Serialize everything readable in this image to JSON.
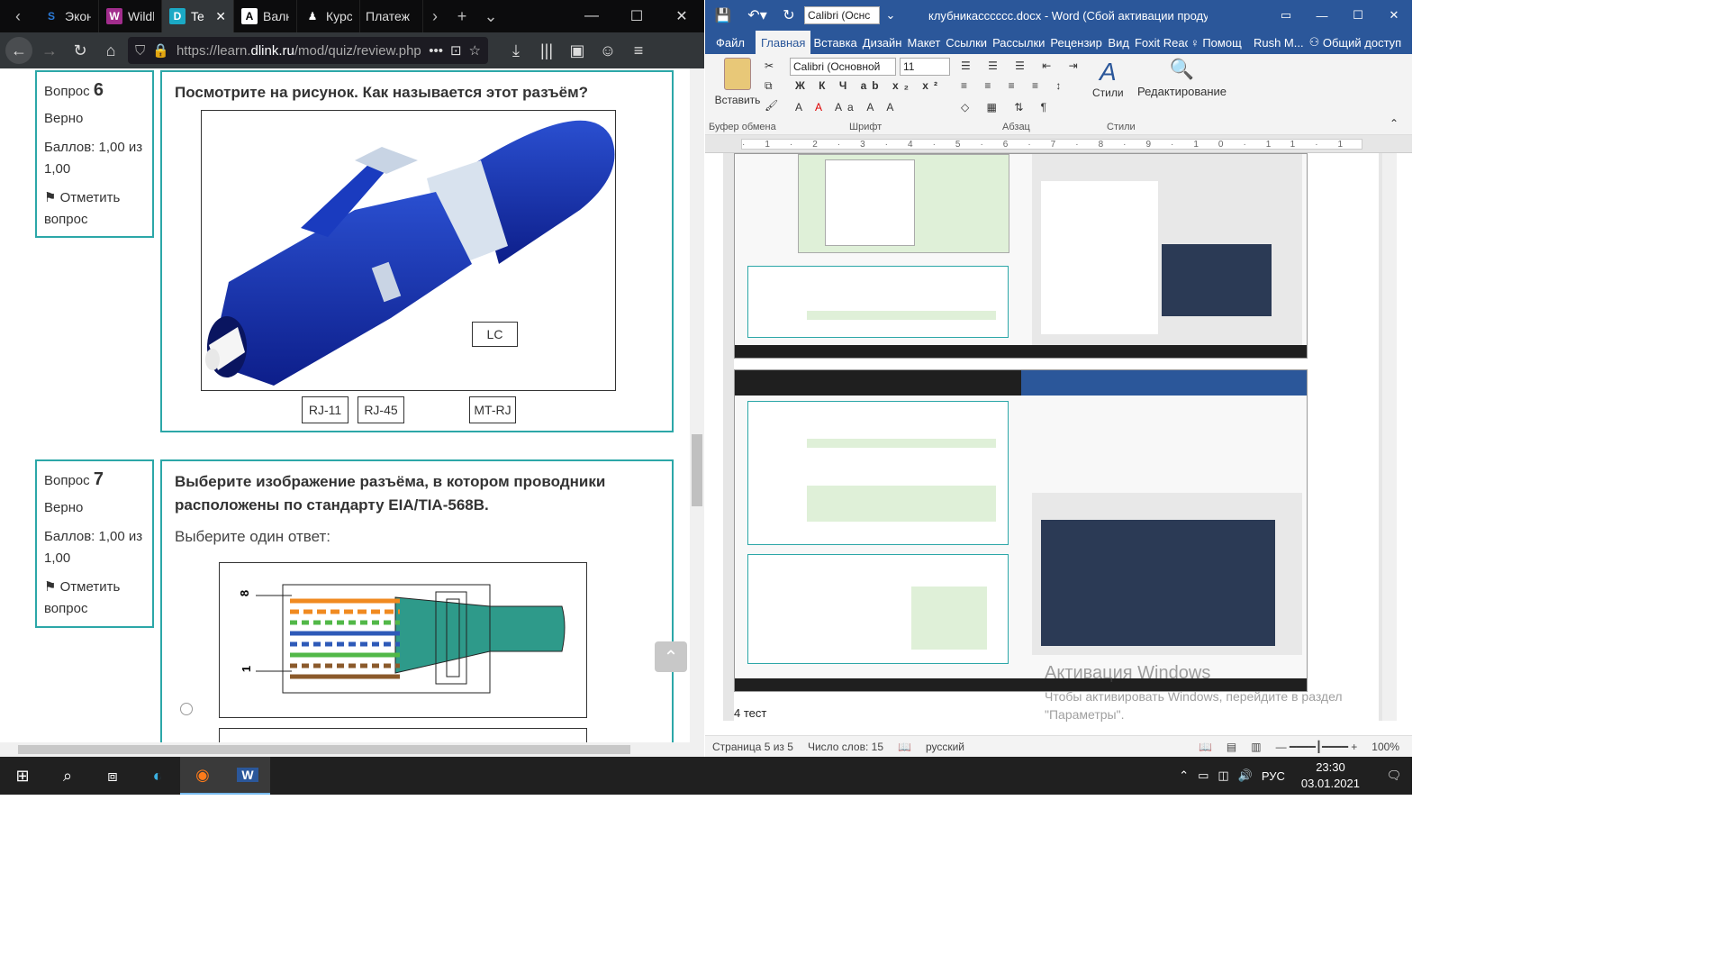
{
  "firefox": {
    "tabs": [
      {
        "label": "Эконо",
        "icon": "S",
        "color": "#2b7bd9"
      },
      {
        "label": "Wildb",
        "icon": "W",
        "color": "#a22d8d"
      },
      {
        "label": "Te",
        "icon": "D",
        "color": "#1ba9c5"
      },
      {
        "label": "Валют",
        "icon": "A",
        "color": "#444"
      },
      {
        "label": "Курс",
        "icon": "♟",
        "color": "#555"
      },
      {
        "label": "Платеж",
        "icon": "",
        "color": "#555"
      }
    ],
    "url_prefix": "https://learn.",
    "url_domain": "dlink.ru",
    "url_suffix": "/mod/quiz/review.php"
  },
  "quiz": {
    "q6": {
      "label": "Вопрос",
      "number": "6",
      "status": "Верно",
      "score": "Баллов: 1,00 из 1,00",
      "flag": "Отметить вопрос",
      "text": "Посмотрите на рисунок. Как называется этот разъём?",
      "answer_in_image": "LC",
      "options": [
        "RJ-11",
        "RJ-45",
        "MT-RJ"
      ]
    },
    "q7": {
      "label": "Вопрос",
      "number": "7",
      "status": "Верно",
      "score": "Баллов: 1,00 из 1,00",
      "flag": "Отметить вопрос",
      "text": "Выберите изображение разъёма, в котором проводники расположены по стандарту EIA/TIA-568B.",
      "choose": "Выберите один ответ:",
      "pin_top": "8",
      "pin_bottom": "1"
    }
  },
  "word": {
    "title": "клубникасссссс.docx - Word (Сбой активации продукта)",
    "tabs": [
      "Файл",
      "Главная",
      "Вставка",
      "Дизайн",
      "Макет",
      "Ссылки",
      "Рассылки",
      "Рецензир",
      "Вид",
      "Foxit Reac",
      "Помощ",
      "Rush M...",
      "Общий доступ"
    ],
    "font_name": "Calibri (Основной",
    "font_size": "11",
    "font_title": "Calibri (Оснс",
    "paste": "Вставить",
    "styles": "Стили",
    "editing": "Редактирование",
    "groups": [
      "Буфер обмена",
      "Шрифт",
      "Абзац",
      "Стили"
    ],
    "page_caption": "4 тест",
    "status": {
      "page": "Страница 5 из 5",
      "words": "Число слов: 15",
      "lang": "русский",
      "zoom": "100%"
    }
  },
  "activation": {
    "title": "Активация Windows",
    "subtitle": "Чтобы активировать Windows, перейдите в раздел \"Параметры\"."
  },
  "taskbar": {
    "lang": "РУС",
    "time": "23:30",
    "date": "03.01.2021"
  }
}
